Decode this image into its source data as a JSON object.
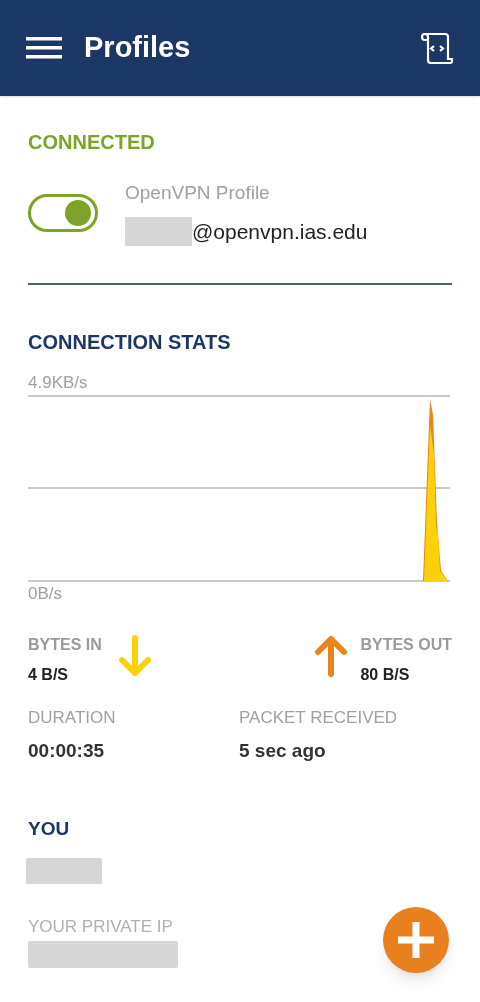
{
  "app_bar": {
    "title": "Profiles"
  },
  "status": {
    "label": "CONNECTED"
  },
  "profile": {
    "name": "OpenVPN Profile",
    "server": "@openvpn.ias.edu",
    "on": true
  },
  "stats": {
    "heading": "CONNECTION STATS",
    "chart": {
      "top_label": "4.9KB/s",
      "bottom_label": "0B/s"
    },
    "bytes_in": {
      "label": "BYTES IN",
      "value": "4 B/S"
    },
    "bytes_out": {
      "label": "BYTES OUT",
      "value": "80 B/S"
    },
    "duration": {
      "label": "DURATION",
      "value": "00:00:35"
    },
    "packet": {
      "label": "PACKET RECEIVED",
      "value": "5 sec ago"
    }
  },
  "you": {
    "heading": "YOU",
    "private_ip_label": "YOUR PRIVATE IP"
  }
}
